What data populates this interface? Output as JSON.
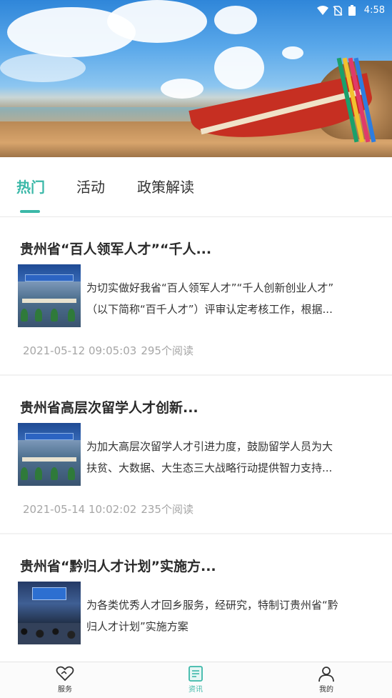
{
  "status_bar": {
    "time": "4:58",
    "icons": [
      "wifi-icon",
      "no-sim-icon",
      "battery-icon"
    ]
  },
  "banner": {
    "image": "beach-boat-banner"
  },
  "tabs": [
    {
      "label": "热门",
      "active": true
    },
    {
      "label": "活动",
      "active": false
    },
    {
      "label": "政策解读",
      "active": false
    }
  ],
  "articles": [
    {
      "title": "贵州省“百人领军人才”“千人...",
      "summary_line1": "为切实做好我省“百人领军人才”“千人创新创业人才”",
      "summary_line2": "（以下简称“百千人才”）评审认定考核工作，根据...",
      "datetime": "2021-05-12 09:05:03",
      "reads": "295个阅读",
      "thumb": "meeting-hall-photo"
    },
    {
      "title": "贵州省高层次留学人才创新...",
      "summary_line1": "为加大高层次留学人才引进力度，鼓励留学人员为大",
      "summary_line2": "扶贫、大数据、大生态三大战略行动提供智力支持...",
      "datetime": "2021-05-14 10:02:02",
      "reads": "235个阅读",
      "thumb": "meeting-hall-photo"
    },
    {
      "title": "贵州省“黔归人才计划”实施方...",
      "summary_line1": "为各类优秀人才回乡服务，经研究，特制订贵州省“黔",
      "summary_line2": "归人才计划”实施方案",
      "thumb": "conference-photo"
    }
  ],
  "bottom_nav": [
    {
      "label": "服务",
      "icon": "heart-service-icon",
      "active": false
    },
    {
      "label": "资讯",
      "icon": "news-document-icon",
      "active": true
    },
    {
      "label": "我的",
      "icon": "user-profile-icon",
      "active": false
    }
  ],
  "colors": {
    "accent": "#3bb8a8",
    "title_text": "#2a2a2a",
    "meta_text": "#a6a6a6"
  }
}
